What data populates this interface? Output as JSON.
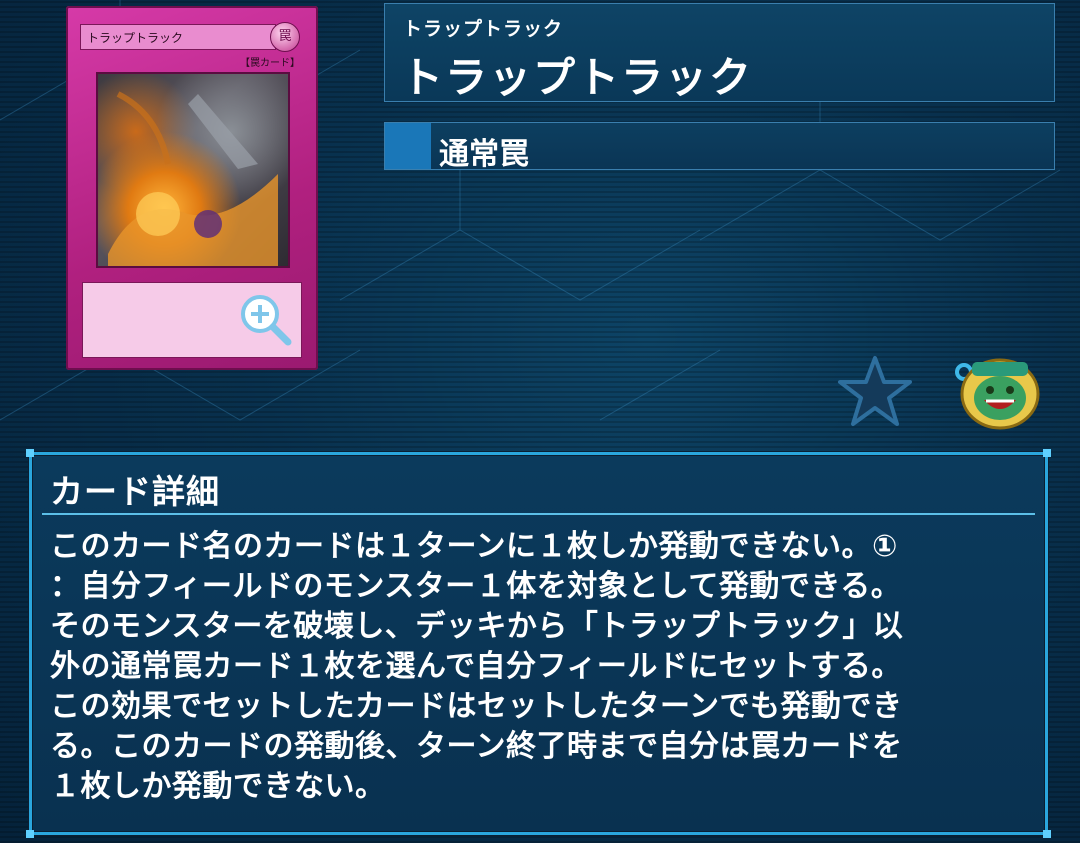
{
  "card_image": {
    "name_on_card": "トラップトラック",
    "attribute_glyph": "罠",
    "type_on_card": "【罠カード】",
    "zoom_icon": "magnifier-plus-icon"
  },
  "header": {
    "ruby": "トラップトラック",
    "name": "トラップトラック"
  },
  "card_type": {
    "label": "通常罠",
    "color": "#1a77b8"
  },
  "actions": {
    "favorite_icon": "star-icon",
    "pot_icon": "pot-of-greed-icon"
  },
  "detail": {
    "title": "カード詳細",
    "text": "このカード名のカードは１ターンに１枚しか発動できない。①\n：自分フィールドのモンスター１体を対象として発動できる。\nそのモンスターを破壊し、デッキから「トラップトラック」以\n外の通常罠カード１枚を選んで自分フィールドにセットする。\nこの効果でセットしたカードはセットしたターンでも発動でき\nる。このカードの発動後、ターン終了時まで自分は罠カードを\n１枚しか発動できない。"
  },
  "colors": {
    "background": "#08304d",
    "panel_border": "#2aa6dd",
    "trap_card": "#c2398f"
  }
}
